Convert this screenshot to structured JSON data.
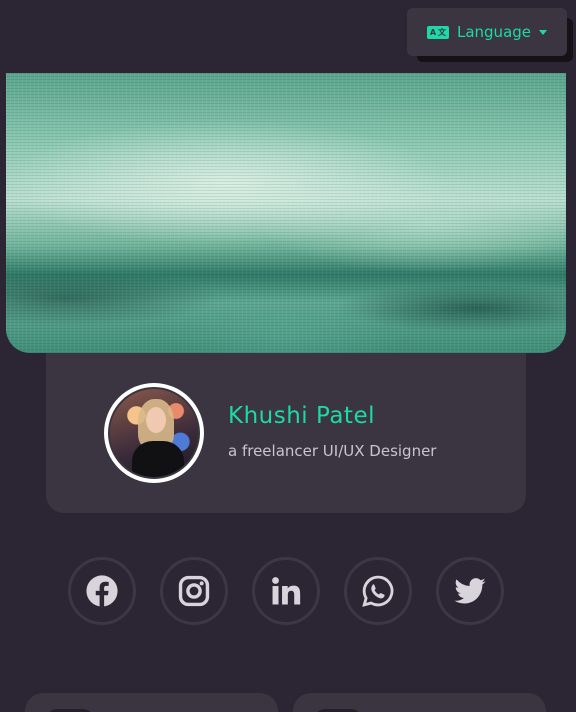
{
  "header": {
    "language_label": "Language",
    "language_icon": "translate-icon"
  },
  "profile": {
    "name": "Khushi Patel",
    "role": "a freelancer UI/UX Designer"
  },
  "social": [
    {
      "name": "facebook",
      "icon": "facebook-icon"
    },
    {
      "name": "instagram",
      "icon": "instagram-icon"
    },
    {
      "name": "linkedin",
      "icon": "linkedin-icon"
    },
    {
      "name": "whatsapp",
      "icon": "whatsapp-icon"
    },
    {
      "name": "twitter",
      "icon": "twitter-icon"
    }
  ],
  "colors": {
    "background": "#2c2533",
    "card": "#3a3540",
    "accent": "#1dd9a8",
    "text_muted": "#c9c4cf"
  }
}
